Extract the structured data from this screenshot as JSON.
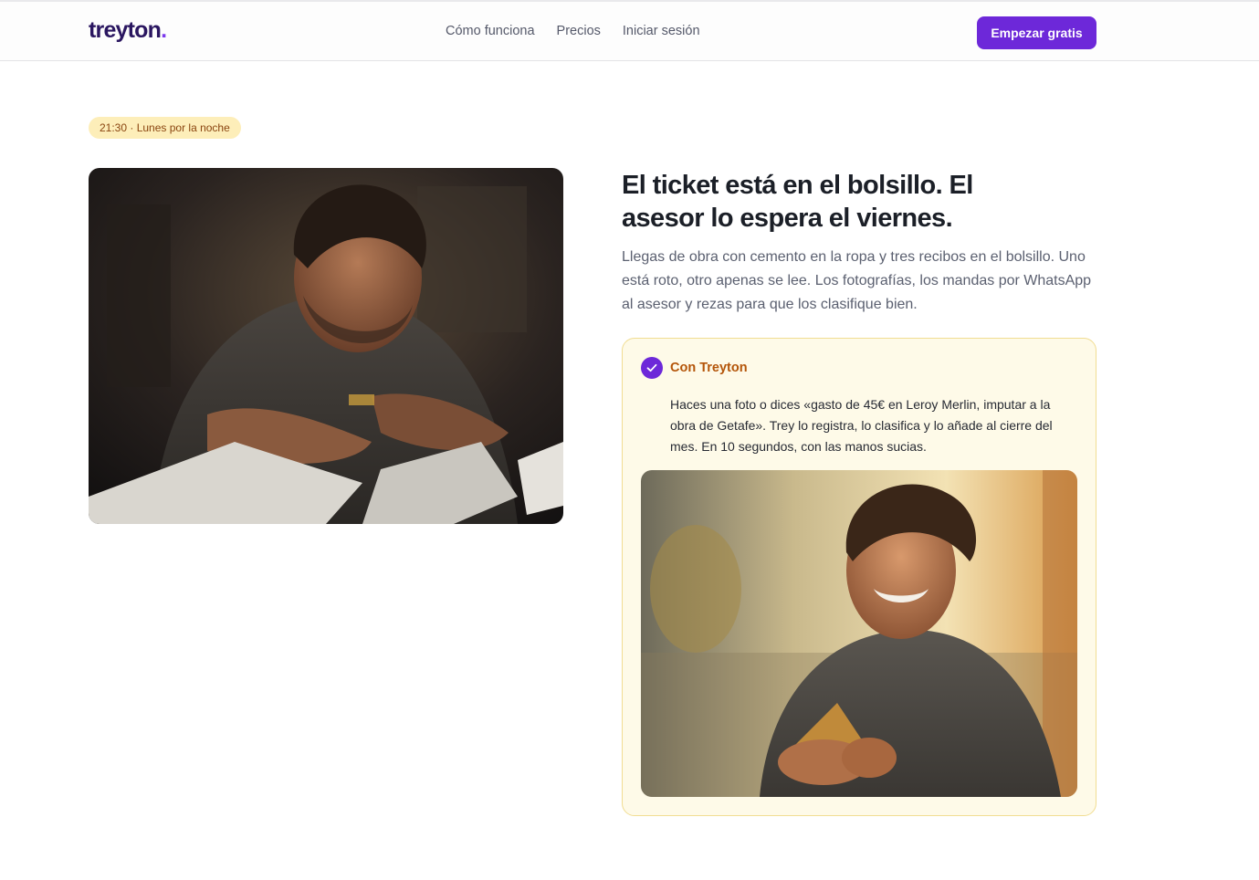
{
  "header": {
    "logo_text": "treyton",
    "logo_dot": ".",
    "nav": [
      {
        "label": "Cómo funciona"
      },
      {
        "label": "Precios"
      },
      {
        "label": "Iniciar sesión"
      }
    ],
    "cta_label": "Empezar gratis"
  },
  "hero": {
    "time_badge": "21:30 · Lunes por la noche",
    "title": "El ticket está en el bolsillo. El asesor lo espera el viernes.",
    "description": "Llegas de obra con cemento en la ropa y tres recibos en el bolsillo. Uno está roto, otro apenas se lee. Los fotografías, los mandas por WhatsApp al asesor y rezas para que los clasifique bien."
  },
  "solution_card": {
    "title": "Con Treyton",
    "text": "Haces una foto o dices «gasto de 45€ en Leroy Merlin, imputar a la obra de Getafe». Trey lo registra, lo clasifica y lo añade al cierre del mes. En 10 segundos, con las manos sucias."
  },
  "colors": {
    "brand": "#6d28d9",
    "logo": "#2a1660",
    "badge_bg": "#fdeeb9",
    "card_bg": "#fefae8",
    "card_border": "#f1dd92",
    "card_title": "#b45509"
  },
  "icons": {
    "check": "check-circle-icon"
  }
}
